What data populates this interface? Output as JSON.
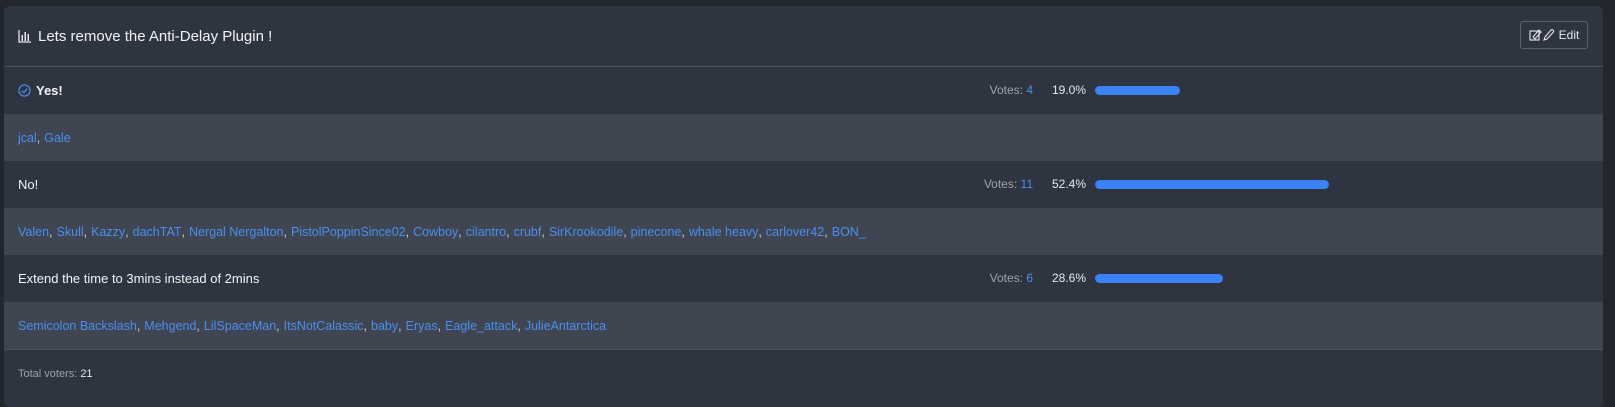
{
  "poll": {
    "title": "Lets remove the Anti-Delay Plugin !",
    "edit_label": "Edit",
    "votes_label": "Votes:",
    "options": [
      {
        "label": "Yes!",
        "selected": true,
        "votes": "4",
        "percent_text": "19.0%",
        "percent": 19.0,
        "voters": [
          "jcal",
          "Gale"
        ]
      },
      {
        "label": "No!",
        "selected": false,
        "votes": "11",
        "percent_text": "52.4%",
        "percent": 52.4,
        "voters": [
          "Valen",
          "Skull",
          "Kazzy",
          "dachTAT",
          "Nergal Nergalton",
          "PistolPoppinSince02",
          "Cowboy",
          "cilantro",
          "crubf",
          "SirKrookodile",
          "pinecone",
          "whale heavy",
          "carlover42",
          "BON_"
        ]
      },
      {
        "label": "Extend the time to 3mins instead of 2mins",
        "selected": false,
        "votes": "6",
        "percent_text": "28.6%",
        "percent": 28.6,
        "voters": [
          "Semicolon Backslash",
          "Mehgend",
          "LilSpaceMan",
          "ItsNotCalassic",
          "baby",
          "Eryas",
          "Eagle_attack",
          "JulieAntarctica"
        ]
      }
    ],
    "footer_label": "Total voters:",
    "total_voters": "21"
  },
  "colors": {
    "accent": "#3b82f6",
    "link": "#4b8ef0"
  },
  "icons": {
    "title": "bar-chart-icon",
    "edit": "edit-icon",
    "selected": "check-circle-icon"
  }
}
